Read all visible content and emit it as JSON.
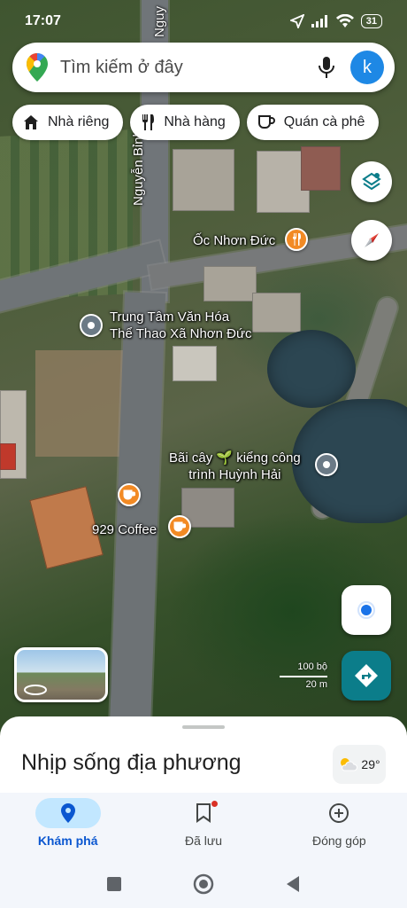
{
  "status_bar": {
    "time": "17:07",
    "battery": "31"
  },
  "search": {
    "placeholder": "Tìm kiếm ở đây",
    "avatar_letter": "k"
  },
  "chips": [
    {
      "label": "Nhà riêng",
      "icon": "home-icon"
    },
    {
      "label": "Nhà hàng",
      "icon": "restaurant-icon"
    },
    {
      "label": "Quán cà phê",
      "icon": "coffee-icon"
    }
  ],
  "map": {
    "roads": [
      "Nguyễn Bỉnh",
      "Nguy"
    ],
    "places": [
      {
        "name": "Ốc Nhơn Đức",
        "type": "restaurant"
      },
      {
        "name": "Trung Tâm Văn Hóa\nThể Thao Xã Nhơn Đức",
        "type": "landmark"
      },
      {
        "name": "Bãi cây 🌱 kiểng công\ntrình Huỳnh Hải",
        "type": "landmark"
      },
      {
        "name": "929 Coffee",
        "type": "cafe"
      }
    ],
    "scale": {
      "imperial": "100 bộ",
      "metric": "20 m"
    },
    "colors": {
      "cafe_pin": "#f28a24",
      "place_pin": "#6b7a86",
      "directions": "#0b7d8a"
    }
  },
  "sheet": {
    "title": "Nhịp sống địa phương",
    "weather": "29°"
  },
  "nav": [
    {
      "label": "Khám phá",
      "icon": "explore-pin-icon",
      "active": true
    },
    {
      "label": "Đã lưu",
      "icon": "bookmark-icon",
      "active": false
    },
    {
      "label": "Đóng góp",
      "icon": "add-circle-icon",
      "active": false
    }
  ]
}
